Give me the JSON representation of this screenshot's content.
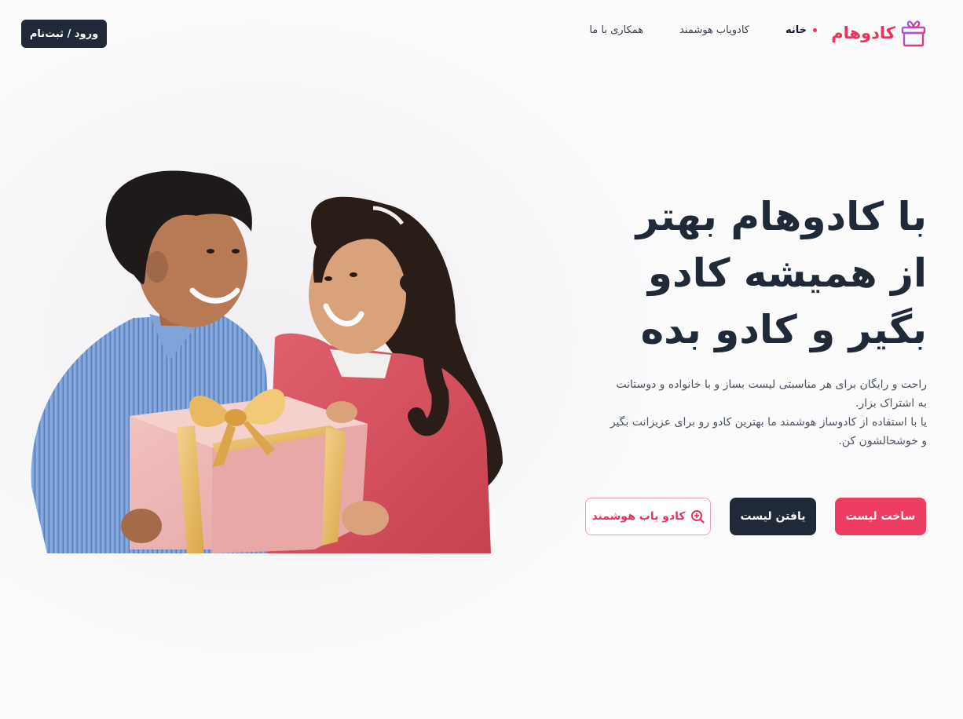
{
  "header": {
    "logo_text": "کادوهام",
    "nav": [
      {
        "label": "خانه",
        "active": true
      },
      {
        "label": "کادویاب هوشمند",
        "active": false
      },
      {
        "label": "همکاری با ما",
        "active": false
      }
    ],
    "auth_label": "ورود / ثبت‌نام"
  },
  "hero": {
    "title_line1": "با کادوهام بهتر",
    "title_line2": "از همیشه کادو",
    "title_line3": "بگیر و کادو بده",
    "desc_line1": "راحت و رایگان برای هر مناسبتی لیست بساز و با خانواده و دوستانت",
    "desc_line2": "به اشتراک بزار.",
    "desc_line3": "یا با استفاده از کادوساز هوشمند ما بهترین کادو رو برای عزیزانت بگیر",
    "desc_line4": "و خوشحالشون کن."
  },
  "actions": {
    "create_list": "ساخت لیست",
    "find_list": "یافتن لیست",
    "smart_gift": "کادو یاب هوشمند"
  },
  "icons": {
    "logo": "gift-icon",
    "smart_gift": "search-plus-icon"
  },
  "colors": {
    "brand": "#e8345c",
    "dark": "#1f2937",
    "background": "#fbfbfc"
  }
}
